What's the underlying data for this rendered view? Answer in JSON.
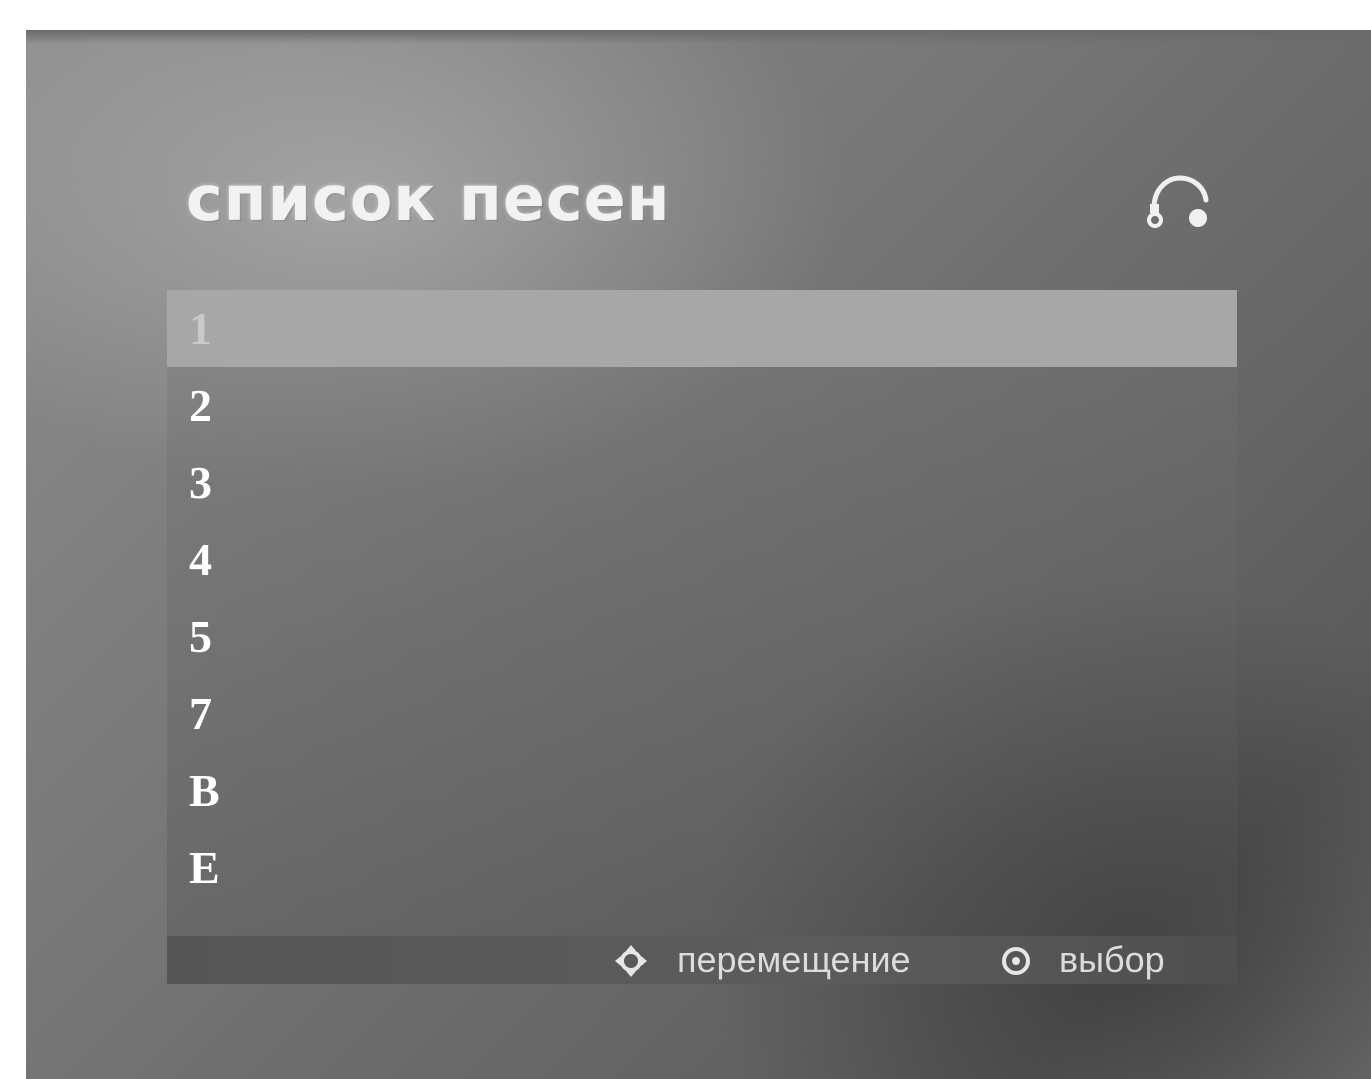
{
  "title": "список песен",
  "mode_icon": "music-disc-icon",
  "tracks": [
    {
      "label": "1",
      "selected": true
    },
    {
      "label": "2",
      "selected": false
    },
    {
      "label": "3",
      "selected": false
    },
    {
      "label": "4",
      "selected": false
    },
    {
      "label": "5",
      "selected": false
    },
    {
      "label": "7",
      "selected": false
    },
    {
      "label": "B",
      "selected": false
    },
    {
      "label": "E",
      "selected": false
    }
  ],
  "footer": {
    "move_icon": "navigation-arrows-icon",
    "move_label": "перемещение",
    "select_icon": "enter-button-icon",
    "select_label": "выбор"
  },
  "colors": {
    "selected_row": "#a7a7a7",
    "text": "#ffffff",
    "footer_bar": "#555555"
  }
}
